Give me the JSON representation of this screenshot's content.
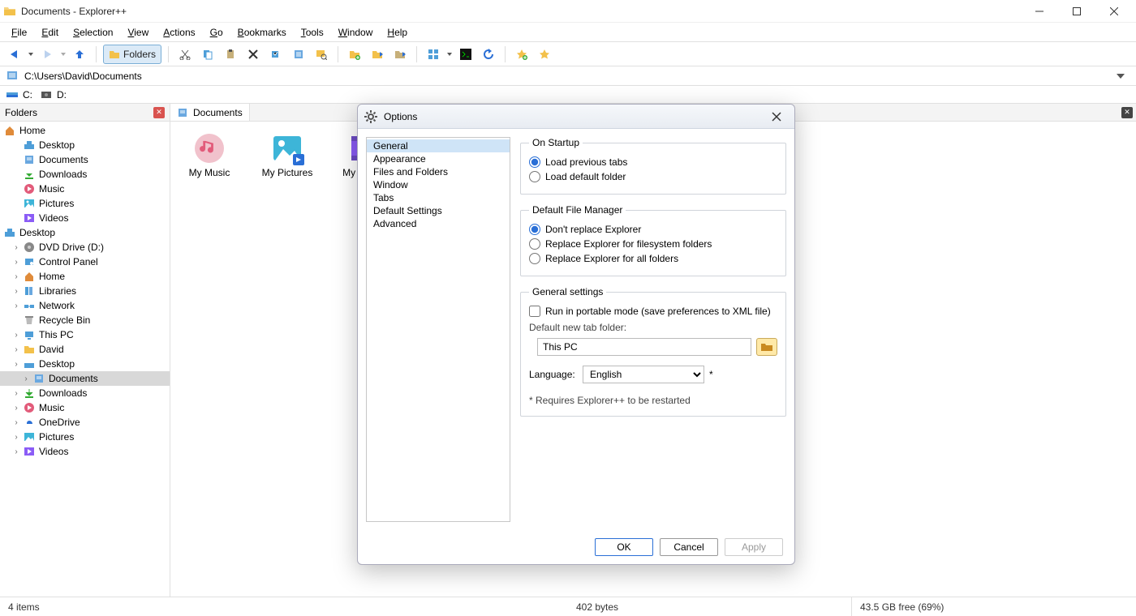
{
  "window": {
    "title": "Documents - Explorer++"
  },
  "menus": [
    "File",
    "Edit",
    "Selection",
    "View",
    "Actions",
    "Go",
    "Bookmarks",
    "Tools",
    "Window",
    "Help"
  ],
  "toolbar": {
    "folders_label": "Folders"
  },
  "address": {
    "path": "C:\\Users\\David\\Documents"
  },
  "drives": [
    "C:",
    "D:"
  ],
  "sidebar": {
    "header": "Folders",
    "tree": {
      "home": {
        "label": "Home",
        "children": [
          "Desktop",
          "Documents",
          "Downloads",
          "Music",
          "Pictures",
          "Videos"
        ]
      },
      "desktop": {
        "label": "Desktop",
        "children": [
          "DVD Drive (D:)",
          "Control Panel",
          "Home",
          "Libraries",
          "Network",
          "Recycle Bin",
          "This PC",
          "David",
          "Desktop",
          "Documents",
          "Downloads",
          "Music",
          "OneDrive",
          "Pictures",
          "Videos"
        ]
      }
    }
  },
  "tabs": [
    {
      "label": "Documents"
    }
  ],
  "files": [
    {
      "name": "My Music",
      "icon": "music"
    },
    {
      "name": "My Pictures",
      "icon": "picture"
    },
    {
      "name": "My Videos",
      "icon": "video"
    }
  ],
  "status": {
    "items": "4 items",
    "size": "402 bytes",
    "disk": "43.5 GB free (69%)"
  },
  "dialog": {
    "title": "Options",
    "nav": [
      "General",
      "Appearance",
      "Files and Folders",
      "Window",
      "Tabs",
      "Default Settings",
      "Advanced"
    ],
    "nav_selected": "General",
    "groups": {
      "startup": {
        "legend": "On Startup",
        "opts": [
          "Load previous tabs",
          "Load default folder"
        ],
        "selected": "Load previous tabs"
      },
      "dfm": {
        "legend": "Default File Manager",
        "opts": [
          "Don't replace Explorer",
          "Replace Explorer for filesystem folders",
          "Replace Explorer for all folders"
        ],
        "selected": "Don't replace Explorer"
      },
      "general": {
        "legend": "General settings",
        "portable_label": "Run in portable mode (save preferences to XML file)",
        "newtab_label": "Default new tab folder:",
        "newtab_value": "This PC",
        "language_label": "Language:",
        "language_value": "English",
        "asterisk": "*",
        "restart_note": "* Requires Explorer++ to be restarted"
      }
    },
    "buttons": {
      "ok": "OK",
      "cancel": "Cancel",
      "apply": "Apply"
    }
  }
}
